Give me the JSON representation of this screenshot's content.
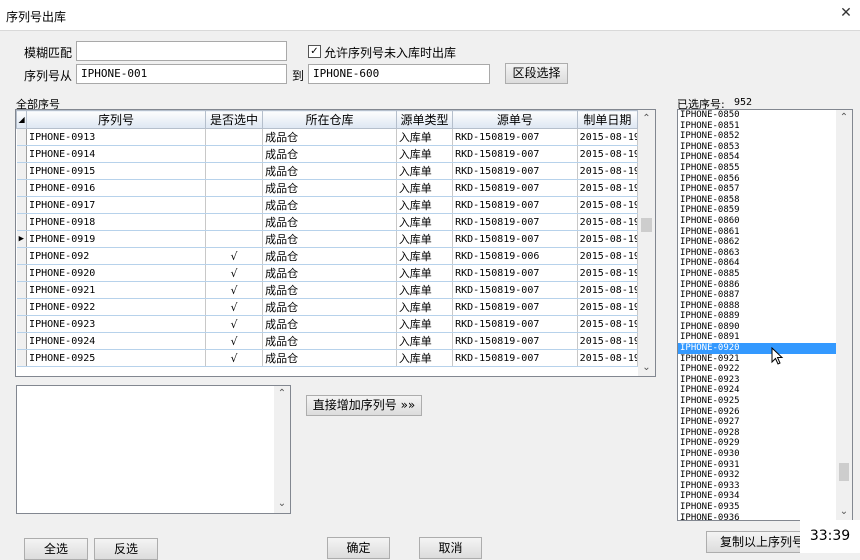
{
  "window": {
    "title": "序列号出库",
    "close": "✕"
  },
  "fuzzy": {
    "label": "模糊匹配",
    "value": ""
  },
  "allow_unstocked": {
    "label": "允许序列号未入库时出库",
    "checked": "☑"
  },
  "range": {
    "from_label": "序列号从",
    "from_value": "IPHONE-001",
    "to_label": "到",
    "to_value": "IPHONE-600",
    "button": "区段选择"
  },
  "all_serials": {
    "label": "全部序号",
    "columns": [
      "序列号",
      "是否选中",
      "所在仓库",
      "源单类型",
      "源单号",
      "制单日期"
    ],
    "rows": [
      {
        "serial": "IPHONE-0913",
        "checked": "",
        "warehouse": "成品仓",
        "type": "入库单",
        "doc": "RKD-150819-007",
        "date": "2015-08-19",
        "current": false
      },
      {
        "serial": "IPHONE-0914",
        "checked": "",
        "warehouse": "成品仓",
        "type": "入库单",
        "doc": "RKD-150819-007",
        "date": "2015-08-19",
        "current": false
      },
      {
        "serial": "IPHONE-0915",
        "checked": "",
        "warehouse": "成品仓",
        "type": "入库单",
        "doc": "RKD-150819-007",
        "date": "2015-08-19",
        "current": false
      },
      {
        "serial": "IPHONE-0916",
        "checked": "",
        "warehouse": "成品仓",
        "type": "入库单",
        "doc": "RKD-150819-007",
        "date": "2015-08-19",
        "current": false
      },
      {
        "serial": "IPHONE-0917",
        "checked": "",
        "warehouse": "成品仓",
        "type": "入库单",
        "doc": "RKD-150819-007",
        "date": "2015-08-19",
        "current": false
      },
      {
        "serial": "IPHONE-0918",
        "checked": "",
        "warehouse": "成品仓",
        "type": "入库单",
        "doc": "RKD-150819-007",
        "date": "2015-08-19",
        "current": false
      },
      {
        "serial": "IPHONE-0919",
        "checked": "",
        "warehouse": "成品仓",
        "type": "入库单",
        "doc": "RKD-150819-007",
        "date": "2015-08-19",
        "current": true
      },
      {
        "serial": "IPHONE-092",
        "checked": "√",
        "warehouse": "成品仓",
        "type": "入库单",
        "doc": "RKD-150819-006",
        "date": "2015-08-19",
        "current": false
      },
      {
        "serial": "IPHONE-0920",
        "checked": "√",
        "warehouse": "成品仓",
        "type": "入库单",
        "doc": "RKD-150819-007",
        "date": "2015-08-19",
        "current": false
      },
      {
        "serial": "IPHONE-0921",
        "checked": "√",
        "warehouse": "成品仓",
        "type": "入库单",
        "doc": "RKD-150819-007",
        "date": "2015-08-19",
        "current": false
      },
      {
        "serial": "IPHONE-0922",
        "checked": "√",
        "warehouse": "成品仓",
        "type": "入库单",
        "doc": "RKD-150819-007",
        "date": "2015-08-19",
        "current": false
      },
      {
        "serial": "IPHONE-0923",
        "checked": "√",
        "warehouse": "成品仓",
        "type": "入库单",
        "doc": "RKD-150819-007",
        "date": "2015-08-19",
        "current": false
      },
      {
        "serial": "IPHONE-0924",
        "checked": "√",
        "warehouse": "成品仓",
        "type": "入库单",
        "doc": "RKD-150819-007",
        "date": "2015-08-19",
        "current": false
      },
      {
        "serial": "IPHONE-0925",
        "checked": "√",
        "warehouse": "成品仓",
        "type": "入库单",
        "doc": "RKD-150819-007",
        "date": "2015-08-19",
        "current": false
      }
    ],
    "current_marker": "▶"
  },
  "memo": {
    "value": ""
  },
  "add_direct_button": "直接增加序列号 »»",
  "selected": {
    "label": "已选序号:",
    "count": "952",
    "items": [
      "IPHONE-0850",
      "IPHONE-0851",
      "IPHONE-0852",
      "IPHONE-0853",
      "IPHONE-0854",
      "IPHONE-0855",
      "IPHONE-0856",
      "IPHONE-0857",
      "IPHONE-0858",
      "IPHONE-0859",
      "IPHONE-0860",
      "IPHONE-0861",
      "IPHONE-0862",
      "IPHONE-0863",
      "IPHONE-0864",
      "IPHONE-0885",
      "IPHONE-0886",
      "IPHONE-0887",
      "IPHONE-0888",
      "IPHONE-0889",
      "IPHONE-0890",
      "IPHONE-0891",
      "IPHONE-0920",
      "IPHONE-0921",
      "IPHONE-0922",
      "IPHONE-0923",
      "IPHONE-0924",
      "IPHONE-0925",
      "IPHONE-0926",
      "IPHONE-0927",
      "IPHONE-0928",
      "IPHONE-0929",
      "IPHONE-0930",
      "IPHONE-0931",
      "IPHONE-0932",
      "IPHONE-0933",
      "IPHONE-0934",
      "IPHONE-0935",
      "IPHONE-0936"
    ],
    "selected_item": "IPHONE-0920"
  },
  "buttons": {
    "select_all": "全选",
    "invert": "反选",
    "ok": "确定",
    "cancel": "取消",
    "copy": "复制以上序列号"
  },
  "clock": "33:39",
  "colors": {
    "selection": "#3399ff",
    "grid_line": "#b7d2eb"
  }
}
